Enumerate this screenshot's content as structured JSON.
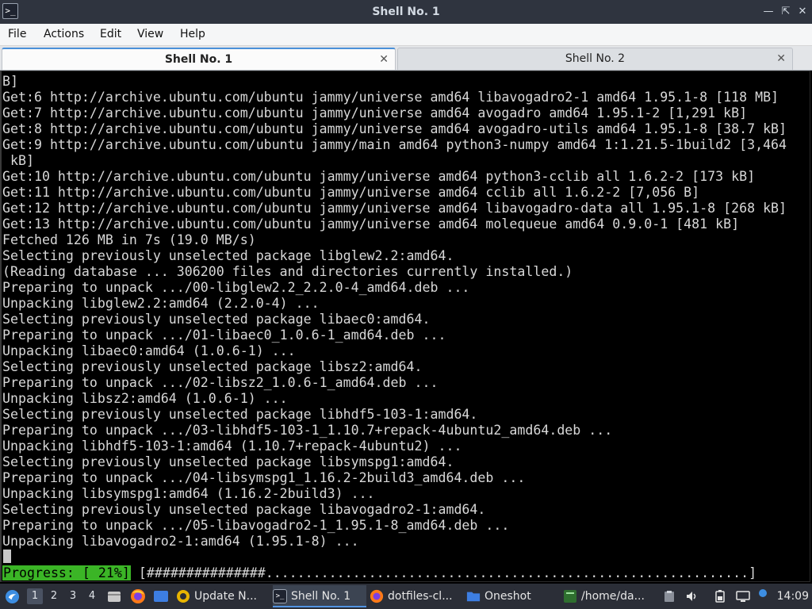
{
  "window": {
    "title": "Shell No. 1",
    "app_icon": "terminal-icon",
    "buttons": [
      "minimize",
      "maximize",
      "close"
    ]
  },
  "menu": {
    "items": [
      "File",
      "Actions",
      "Edit",
      "View",
      "Help"
    ]
  },
  "tabs": [
    {
      "label": "Shell No. 1",
      "active": true
    },
    {
      "label": "Shell No. 2",
      "active": false
    }
  ],
  "terminal": {
    "lines": [
      "B]",
      "Get:6 http://archive.ubuntu.com/ubuntu jammy/universe amd64 libavogadro2-1 amd64 1.95.1-8 [118 MB]",
      "Get:7 http://archive.ubuntu.com/ubuntu jammy/universe amd64 avogadro amd64 1.95.1-2 [1,291 kB]",
      "Get:8 http://archive.ubuntu.com/ubuntu jammy/universe amd64 avogadro-utils amd64 1.95.1-8 [38.7 kB]",
      "Get:9 http://archive.ubuntu.com/ubuntu jammy/main amd64 python3-numpy amd64 1:1.21.5-1build2 [3,464",
      " kB]",
      "Get:10 http://archive.ubuntu.com/ubuntu jammy/universe amd64 python3-cclib all 1.6.2-2 [173 kB]",
      "Get:11 http://archive.ubuntu.com/ubuntu jammy/universe amd64 cclib all 1.6.2-2 [7,056 B]",
      "Get:12 http://archive.ubuntu.com/ubuntu jammy/universe amd64 libavogadro-data all 1.95.1-8 [268 kB]",
      "Get:13 http://archive.ubuntu.com/ubuntu jammy/universe amd64 molequeue amd64 0.9.0-1 [481 kB]",
      "Fetched 126 MB in 7s (19.0 MB/s)",
      "Selecting previously unselected package libglew2.2:amd64.",
      "(Reading database ... 306200 files and directories currently installed.)",
      "Preparing to unpack .../00-libglew2.2_2.2.0-4_amd64.deb ...",
      "Unpacking libglew2.2:amd64 (2.2.0-4) ...",
      "Selecting previously unselected package libaec0:amd64.",
      "Preparing to unpack .../01-libaec0_1.0.6-1_amd64.deb ...",
      "Unpacking libaec0:amd64 (1.0.6-1) ...",
      "Selecting previously unselected package libsz2:amd64.",
      "Preparing to unpack .../02-libsz2_1.0.6-1_amd64.deb ...",
      "Unpacking libsz2:amd64 (1.0.6-1) ...",
      "Selecting previously unselected package libhdf5-103-1:amd64.",
      "Preparing to unpack .../03-libhdf5-103-1_1.10.7+repack-4ubuntu2_amd64.deb ...",
      "Unpacking libhdf5-103-1:amd64 (1.10.7+repack-4ubuntu2) ...",
      "Selecting previously unselected package libsymspg1:amd64.",
      "Preparing to unpack .../04-libsymspg1_1.16.2-2build3_amd64.deb ...",
      "Unpacking libsymspg1:amd64 (1.16.2-2build3) ...",
      "Selecting previously unselected package libavogadro2-1:amd64.",
      "Preparing to unpack .../05-libavogadro2-1_1.95.1-8_amd64.deb ...",
      "Unpacking libavogadro2-1:amd64 (1.95.1-8) ..."
    ],
    "progress_label": "Progress: [ 21%]",
    "progress_bar": "[###############.............................................................]",
    "progress_percent": 21,
    "progress_color": "#3bb526"
  },
  "taskbar": {
    "start_icon": "start-menu-icon",
    "workspaces": [
      "1",
      "2",
      "3",
      "4"
    ],
    "active_workspace": "1",
    "launchers": [
      "file-manager-icon",
      "firefox-icon",
      "show-desktop-icon"
    ],
    "tasks": [
      {
        "label": "Update N...",
        "icon": "update-manager-icon",
        "active": false
      },
      {
        "label": "Shell No. 1",
        "icon": "terminal-icon",
        "active": true
      },
      {
        "label": "dotfiles-cl...",
        "icon": "firefox-icon",
        "active": false
      },
      {
        "label": "Oneshot",
        "icon": "folder-icon",
        "active": false
      },
      {
        "label": "/home/da...",
        "icon": "terminal-icon",
        "active": false
      }
    ],
    "tray": [
      "clipboard-icon",
      "volume-icon",
      "battery-icon",
      "network-icon"
    ],
    "clock": "14:09"
  },
  "colors": {
    "accent": "#5294e2",
    "titlebar_bg": "#2f343f",
    "terminal_bg": "#000000",
    "terminal_fg": "#d8d8d8"
  }
}
